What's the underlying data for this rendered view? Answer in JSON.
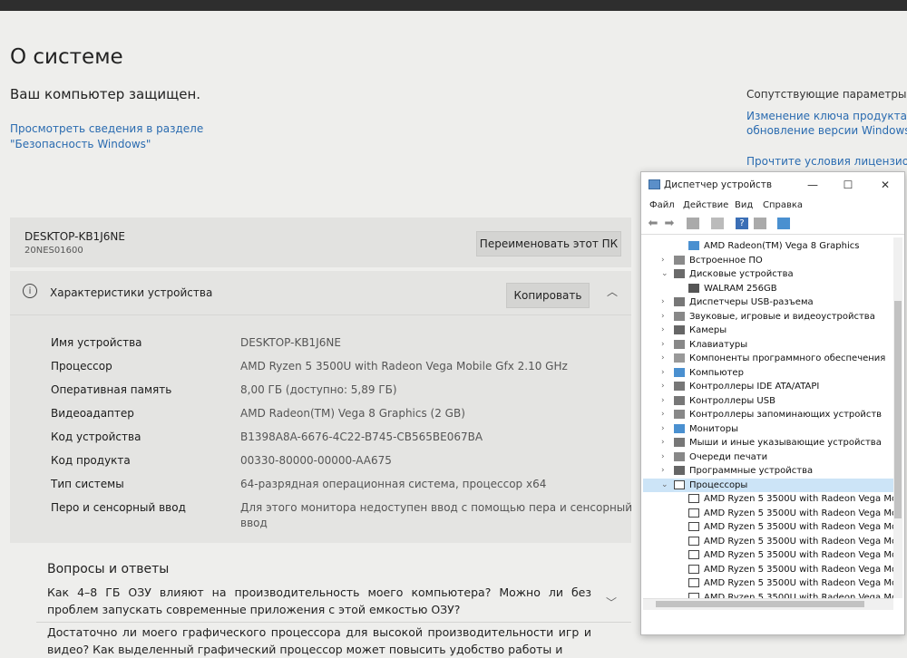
{
  "page": {
    "title": "О системе",
    "protected_text": "Ваш компьютер защищен.",
    "security_link": "Просмотреть сведения в разделе \"Безопасность Windows\""
  },
  "related": {
    "heading": "Сопутствующие параметры",
    "links": [
      "Изменение ключа продукта или",
      "обновление версии Windows",
      "Прочтите условия лицензионно"
    ]
  },
  "pc": {
    "name": "DESKTOP-KB1J6NE",
    "model": "20NES01600",
    "rename_label": "Переименовать этот ПК"
  },
  "specs": {
    "title": "Характеристики устройства",
    "copy_label": "Копировать",
    "rows": [
      {
        "label": "Имя устройства",
        "value": "DESKTOP-KB1J6NE"
      },
      {
        "label": "Процессор",
        "value": "AMD Ryzen 5 3500U with Radeon Vega Mobile Gfx     2.10 GHz"
      },
      {
        "label": "Оперативная память",
        "value": "8,00 ГБ (доступно: 5,89 ГБ)"
      },
      {
        "label": "Видеоадаптер",
        "value": "AMD Radeon(TM) Vega 8 Graphics (2 GB)"
      },
      {
        "label": "Код устройства",
        "value": "B1398A8A-6676-4C22-B745-CB565BE067BA"
      },
      {
        "label": "Код продукта",
        "value": "00330-80000-00000-AA675"
      },
      {
        "label": "Тип системы",
        "value": "64-разрядная операционная система, процессор x64"
      },
      {
        "label": "Перо и сенсорный ввод",
        "value": "Для этого монитора недоступен ввод с помощью пера и сенсорный",
        "value2": "ввод"
      }
    ]
  },
  "qa": {
    "title": "Вопросы и ответы",
    "questions": [
      "Как 4–8 ГБ ОЗУ влияют на производительность моего компьютера? Можно ли без проблем запускать современные приложения с этой емкостью ОЗУ?",
      "Достаточно ли моего графического процессора для высокой производительности игр и видео? Как выделенный графический процессор может повысить удобство работы и"
    ]
  },
  "device_manager": {
    "title": "Диспетчер устройств",
    "menu": [
      "Файл",
      "Действие",
      "Вид",
      "Справка"
    ],
    "tree": [
      {
        "label": "AMD Radeon(TM) Vega 8 Graphics",
        "level": 2,
        "arrow": "",
        "icon": "monitor-icon",
        "color": "#4a90d0"
      },
      {
        "label": "Встроенное ПО",
        "level": 1,
        "arrow": "›",
        "icon": "firmware-icon",
        "color": "#8a8a8a"
      },
      {
        "label": "Дисковые устройства",
        "level": 1,
        "arrow": "⌄",
        "icon": "disk-icon",
        "color": "#6a6a6a"
      },
      {
        "label": "WALRAM 256GB",
        "level": 2,
        "arrow": "",
        "icon": "disk-icon",
        "color": "#555555"
      },
      {
        "label": "Диспетчеры USB-разъема",
        "level": 1,
        "arrow": "›",
        "icon": "usb-icon",
        "color": "#777777"
      },
      {
        "label": "Звуковые, игровые и видеоустройства",
        "level": 1,
        "arrow": "›",
        "icon": "speaker-icon",
        "color": "#888888"
      },
      {
        "label": "Камеры",
        "level": 1,
        "arrow": "›",
        "icon": "camera-icon",
        "color": "#666666"
      },
      {
        "label": "Клавиатуры",
        "level": 1,
        "arrow": "›",
        "icon": "keyboard-icon",
        "color": "#888888"
      },
      {
        "label": "Компоненты программного обеспечения",
        "level": 1,
        "arrow": "›",
        "icon": "component-icon",
        "color": "#999999"
      },
      {
        "label": "Компьютер",
        "level": 1,
        "arrow": "›",
        "icon": "computer-icon",
        "color": "#4a90d0"
      },
      {
        "label": "Контроллеры IDE ATA/ATAPI",
        "level": 1,
        "arrow": "›",
        "icon": "ide-icon",
        "color": "#777777"
      },
      {
        "label": "Контроллеры USB",
        "level": 1,
        "arrow": "›",
        "icon": "usb-icon",
        "color": "#777777"
      },
      {
        "label": "Контроллеры запоминающих устройств",
        "level": 1,
        "arrow": "›",
        "icon": "storage-icon",
        "color": "#888888"
      },
      {
        "label": "Мониторы",
        "level": 1,
        "arrow": "›",
        "icon": "monitor-icon",
        "color": "#4a90d0"
      },
      {
        "label": "Мыши и иные указывающие устройства",
        "level": 1,
        "arrow": "›",
        "icon": "mouse-icon",
        "color": "#777777"
      },
      {
        "label": "Очереди печати",
        "level": 1,
        "arrow": "›",
        "icon": "printer-icon",
        "color": "#888888"
      },
      {
        "label": "Программные устройства",
        "level": 1,
        "arrow": "›",
        "icon": "software-device-icon",
        "color": "#666666"
      },
      {
        "label": "Процессоры",
        "level": 1,
        "arrow": "⌄",
        "icon": "cpu-icon",
        "color": "#444444",
        "selected": true
      },
      {
        "label": "AMD Ryzen 5 3500U with Radeon Vega Mobi",
        "level": 2,
        "arrow": "",
        "icon": "cpu-icon",
        "color": "#444444"
      },
      {
        "label": "AMD Ryzen 5 3500U with Radeon Vega Mobi",
        "level": 2,
        "arrow": "",
        "icon": "cpu-icon",
        "color": "#444444"
      },
      {
        "label": "AMD Ryzen 5 3500U with Radeon Vega Mobi",
        "level": 2,
        "arrow": "",
        "icon": "cpu-icon",
        "color": "#444444"
      },
      {
        "label": "AMD Ryzen 5 3500U with Radeon Vega Mobi",
        "level": 2,
        "arrow": "",
        "icon": "cpu-icon",
        "color": "#444444"
      },
      {
        "label": "AMD Ryzen 5 3500U with Radeon Vega Mobi",
        "level": 2,
        "arrow": "",
        "icon": "cpu-icon",
        "color": "#444444"
      },
      {
        "label": "AMD Ryzen 5 3500U with Radeon Vega Mobi",
        "level": 2,
        "arrow": "",
        "icon": "cpu-icon",
        "color": "#444444"
      },
      {
        "label": "AMD Ryzen 5 3500U with Radeon Vega Mobi",
        "level": 2,
        "arrow": "",
        "icon": "cpu-icon",
        "color": "#444444"
      },
      {
        "label": "AMD Ryzen 5 3500U with Radeon Vega Mobi",
        "level": 2,
        "arrow": "",
        "icon": "cpu-icon",
        "color": "#444444"
      }
    ]
  },
  "colors": {
    "link": "#2a6bb0",
    "background": "#eeeeec",
    "card": "#e2e2e0",
    "selection": "#cce4f7"
  }
}
